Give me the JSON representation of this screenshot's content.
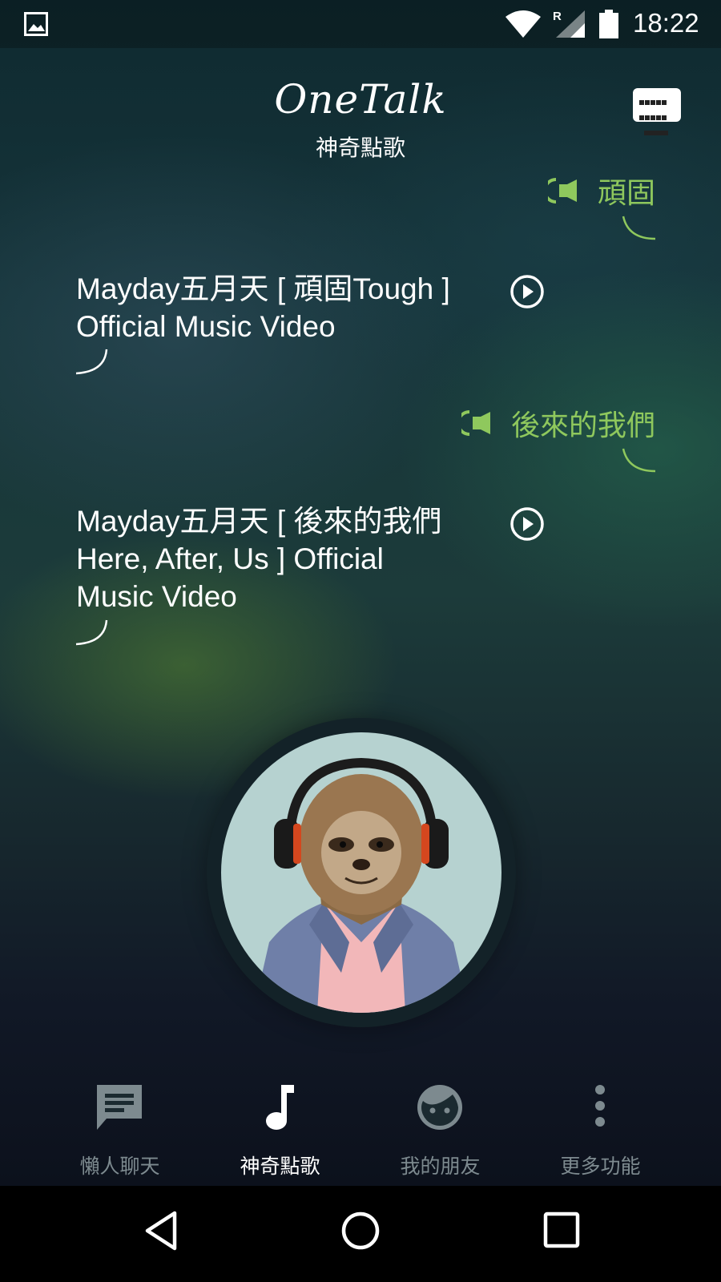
{
  "status_bar": {
    "time": "18:22",
    "network_label": "R",
    "icons": [
      "image-icon",
      "wifi-icon",
      "cell-signal-icon",
      "battery-icon"
    ]
  },
  "header": {
    "logo": "OneTalk",
    "subtitle": "神奇點歌",
    "keyboard_icon": "keyboard-icon"
  },
  "chat": [
    {
      "type": "sent",
      "text": "頑固"
    },
    {
      "type": "reply",
      "text": "Mayday五月天 [ 頑固Tough ] Official Music Video"
    },
    {
      "type": "sent",
      "text": "後來的我們"
    },
    {
      "type": "reply",
      "text": "Mayday五月天 [ 後來的我們 Here, After, Us ] Official Music Video"
    }
  ],
  "avatar": {
    "icon": "sloth-with-headphones-avatar"
  },
  "bottom_nav": [
    {
      "label": "懶人聊天",
      "icon": "chat-bubble-icon",
      "active": false
    },
    {
      "label": "神奇點歌",
      "icon": "music-note-icon",
      "active": true
    },
    {
      "label": "我的朋友",
      "icon": "face-icon",
      "active": false
    },
    {
      "label": "更多功能",
      "icon": "more-vert-icon",
      "active": false
    }
  ],
  "system_nav": {
    "icons": [
      "back-icon",
      "home-icon",
      "recents-icon"
    ]
  },
  "colors": {
    "accent_green": "#8fc85d",
    "active_nav": "#ffffff",
    "inactive_nav": "#7d8a8f"
  }
}
